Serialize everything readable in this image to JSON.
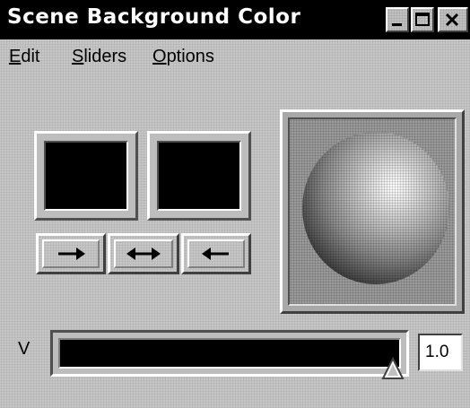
{
  "window": {
    "title": "Scene Background Color"
  },
  "titlebar_buttons": {
    "minimize_icon": "minimize-icon",
    "maximize_icon": "maximize-icon",
    "close_icon": "close-icon"
  },
  "menu": {
    "items": [
      "Edit",
      "Sliders",
      "Options"
    ]
  },
  "swatches": {
    "left_color": "#000000",
    "right_color": "#000000"
  },
  "arrow_buttons": {
    "right_icon": "arrow-right-icon",
    "both_icon": "arrow-left-right-icon",
    "left_icon": "arrow-left-icon"
  },
  "slider": {
    "label": "V",
    "value": "1.0",
    "fraction": 1.0
  },
  "colors": {
    "title_bar": "#000000",
    "window_bg": "#c6c6c6",
    "swatch": "#000000"
  }
}
